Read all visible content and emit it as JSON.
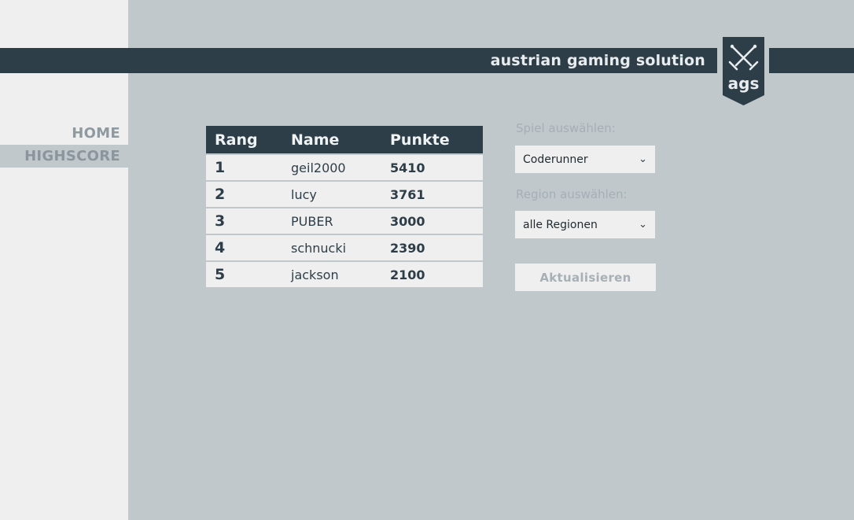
{
  "brand": {
    "tagline": "austrian gaming solution",
    "logo_text": "ags"
  },
  "nav": {
    "items": [
      {
        "label": "HOME"
      },
      {
        "label": "HIGHSCORE"
      }
    ]
  },
  "table": {
    "headers": {
      "rank": "Rang",
      "name": "Name",
      "points": "Punkte"
    },
    "rows": [
      {
        "rank": "1",
        "name": "geil2000",
        "points": "5410"
      },
      {
        "rank": "2",
        "name": "lucy",
        "points": "3761"
      },
      {
        "rank": "3",
        "name": "PUBER",
        "points": "3000"
      },
      {
        "rank": "4",
        "name": "schnucki",
        "points": "2390"
      },
      {
        "rank": "5",
        "name": "jackson",
        "points": "2100"
      }
    ]
  },
  "filters": {
    "game_label": "Spiel auswählen:",
    "game_value": "Coderunner",
    "region_label": "Region auswählen:",
    "region_value": "alle Regionen",
    "refresh_label": "Aktualisieren"
  },
  "icons": {
    "logo": "crossed-swords-icon",
    "select_arrow": "chevron-down-icon"
  },
  "colors": {
    "header": "#2e3e48",
    "background": "#c0c8cb",
    "panel": "#efefef"
  }
}
